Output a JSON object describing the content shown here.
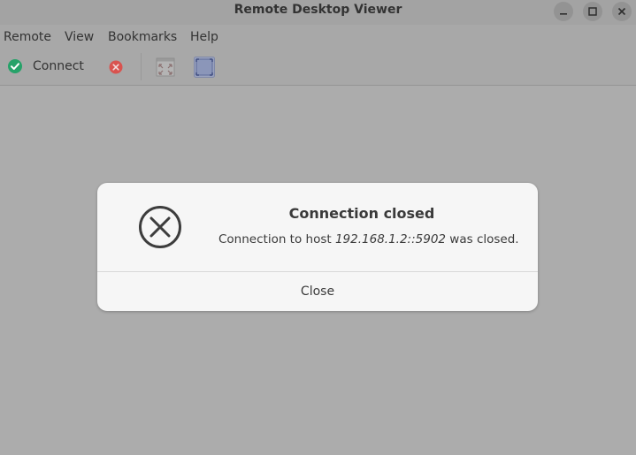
{
  "window": {
    "title": "Remote Desktop Viewer"
  },
  "menu": {
    "items": [
      "Remote",
      "View",
      "Bookmarks",
      "Help"
    ]
  },
  "toolbar": {
    "connect_label": "Connect",
    "icons": {
      "connect": "check-circle-icon",
      "disconnect": "x-circle-icon",
      "fullscreen": "fullscreen-icon",
      "scaling": "scaling-icon"
    }
  },
  "dialog": {
    "icon": "x-circle-icon",
    "title": "Connection closed",
    "message_prefix": "Connection to host ",
    "host": "192.168.1.2::5902",
    "message_suffix": " was closed.",
    "close_label": "Close"
  },
  "colors": {
    "connect_green": "#26a269",
    "disconnect_red": "#d9534f",
    "background": "#acacac",
    "dialog_bg": "#f6f6f6"
  }
}
